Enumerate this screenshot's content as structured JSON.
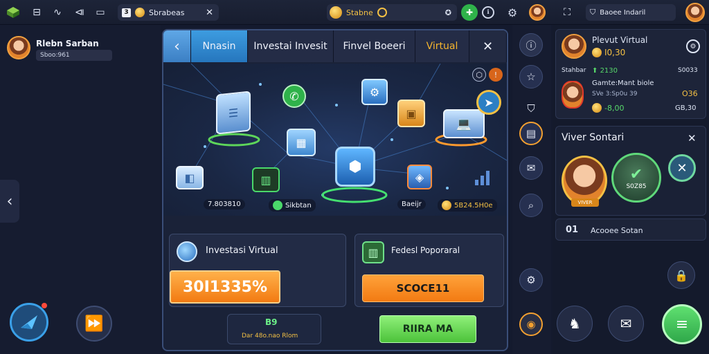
{
  "topbar": {
    "search_chip_num": "3",
    "search_chip_label": "Sbrabeas",
    "coin_chip_label": "Stabne",
    "profile_chip_label": "Baoee Indaril"
  },
  "left": {
    "user_name": "Rlebn Sarban",
    "user_tag": "Sboo:961"
  },
  "panel": {
    "tabs": [
      {
        "label": "Nnasin"
      },
      {
        "label": "Investai Invesit"
      },
      {
        "label": "Finvel Boeeri"
      },
      {
        "label": "Virtual"
      }
    ],
    "network_labels": {
      "left": "7.803810",
      "mid": "Sikbtan",
      "right_top": "Baeijr",
      "right": "5B24.5H0e"
    },
    "card_left": {
      "title": "Investasi Virtual",
      "button": "30I1335%"
    },
    "card_right": {
      "title": "Fedesl Poporaral",
      "button": "SCOCE11"
    },
    "footer_badge_top": "B9",
    "footer_badge_label": "Dar 48o.nao Rlom",
    "footer_button": "RIIRA MA"
  },
  "right": {
    "player_title": "Plevut Virtual",
    "player_value": "I0,30",
    "row1_label": "Stahbar",
    "row1_value": "2130",
    "row1_right": "S0033",
    "row2_title": "Gamte:Mant biole",
    "row2_sub": "SVe 3:Sp0u 39",
    "row2_gold": "O36",
    "row2_value": "-8,00",
    "row2_right": "GB,30",
    "viewer_title": "Viver Sontari",
    "viewer_badge_label": "S0Z85",
    "avatar_caption": "VIVER",
    "bottom_card_num": "01",
    "bottom_card_label": "Acooee Sotan"
  },
  "colors": {
    "accent_blue": "#3d9ce0",
    "gold": "#f3c044",
    "green": "#57d86a",
    "orange_button": "#f7931e"
  }
}
